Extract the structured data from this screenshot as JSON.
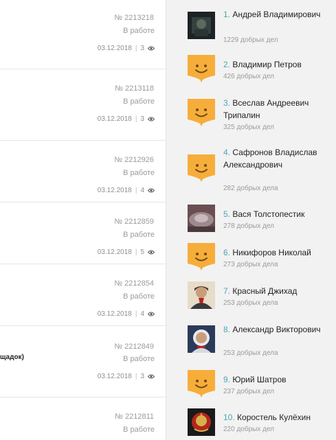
{
  "requests": [
    {
      "number": "№ 2213218",
      "status": "В работе",
      "date": "03.12.2018",
      "views": "3",
      "title": ""
    },
    {
      "number": "№ 2213118",
      "status": "В работе",
      "date": "03.12.2018",
      "views": "3",
      "title": ""
    },
    {
      "number": "№ 2212926",
      "status": "В работе",
      "date": "03.12.2018",
      "views": "4",
      "title": ""
    },
    {
      "number": "№ 2212859",
      "status": "В работе",
      "date": "03.12.2018",
      "views": "5",
      "title": ""
    },
    {
      "number": "№ 2212854",
      "status": "В работе",
      "date": "03.12.2018",
      "views": "4",
      "title": ""
    },
    {
      "number": "№ 2212849",
      "status": "В работе",
      "date": "03.12.2018",
      "views": "3",
      "title": "щадок)"
    },
    {
      "number": "№ 2212811",
      "status": "В работе",
      "date": "",
      "views": "",
      "title": ""
    }
  ],
  "date_separator": "|",
  "leaderboard": [
    {
      "rank": "1.",
      "name": "Андрей Владимирович",
      "deeds": "1229 добрых дел",
      "avatar": "photo-dark"
    },
    {
      "rank": "2.",
      "name": "Владимир Петров",
      "deeds": "426 добрых дел",
      "avatar": "smiley"
    },
    {
      "rank": "3.",
      "name": "Всеслав Андреевич Трипалин",
      "deeds": "325 добрых дел",
      "avatar": "smiley"
    },
    {
      "rank": "4.",
      "name": "Сафронов Владислав Александрович",
      "deeds": "282 добрых дела",
      "avatar": "smiley"
    },
    {
      "rank": "5.",
      "name": "Вася Толстопестик",
      "deeds": "278 добрых дел",
      "avatar": "photo-car"
    },
    {
      "rank": "6.",
      "name": "Никифоров Николай",
      "deeds": "273 добрых дела",
      "avatar": "smiley"
    },
    {
      "rank": "7.",
      "name": "Красный Джихад",
      "deeds": "253 добрых дела",
      "avatar": "photo-portrait"
    },
    {
      "rank": "8.",
      "name": "Александр Викторович",
      "deeds": "253 добрых дела",
      "avatar": "photo-cosmonaut"
    },
    {
      "rank": "9.",
      "name": "Юрий Шатров",
      "deeds": "237 добрых дел",
      "avatar": "smiley"
    },
    {
      "rank": "10.",
      "name": "Коростель Кулёхин",
      "deeds": "220 добрых дел",
      "avatar": "photo-emblem"
    }
  ],
  "colors": {
    "accent": "#4aa6b2",
    "smiley_bg": "#f7ad3a",
    "panel_bg": "#f2f2f2"
  }
}
